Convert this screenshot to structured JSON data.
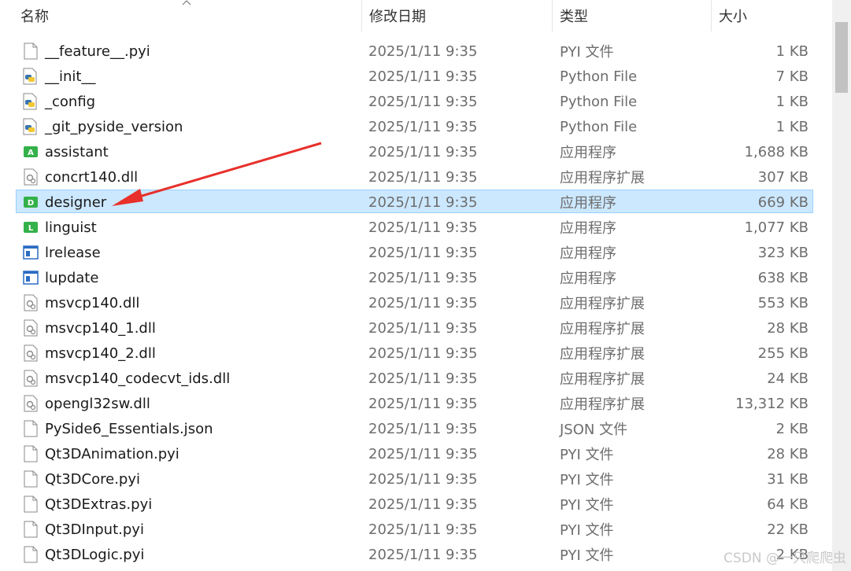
{
  "header": {
    "col_name": "名称",
    "col_date": "修改日期",
    "col_type": "类型",
    "col_size": "大小"
  },
  "files": [
    {
      "name": "__feature__.pyi",
      "date": "2025/1/11 9:35",
      "type": "PYI 文件",
      "size": "1 KB",
      "icon": "doc-icon"
    },
    {
      "name": "__init__",
      "date": "2025/1/11 9:35",
      "type": "Python File",
      "size": "7 KB",
      "icon": "python-icon"
    },
    {
      "name": "_config",
      "date": "2025/1/11 9:35",
      "type": "Python File",
      "size": "1 KB",
      "icon": "python-icon"
    },
    {
      "name": "_git_pyside_version",
      "date": "2025/1/11 9:35",
      "type": "Python File",
      "size": "1 KB",
      "icon": "python-icon"
    },
    {
      "name": "assistant",
      "date": "2025/1/11 9:35",
      "type": "应用程序",
      "size": "1,688 KB",
      "icon": "app-green-icon",
      "letter": "A"
    },
    {
      "name": "concrt140.dll",
      "date": "2025/1/11 9:35",
      "type": "应用程序扩展",
      "size": "307 KB",
      "icon": "dll-icon"
    },
    {
      "name": "designer",
      "date": "2025/1/11 9:35",
      "type": "应用程序",
      "size": "669 KB",
      "icon": "app-green-icon",
      "letter": "D"
    },
    {
      "name": "linguist",
      "date": "2025/1/11 9:35",
      "type": "应用程序",
      "size": "1,077 KB",
      "icon": "app-green-icon",
      "letter": "L"
    },
    {
      "name": "lrelease",
      "date": "2025/1/11 9:35",
      "type": "应用程序",
      "size": "323 KB",
      "icon": "exe-window-icon"
    },
    {
      "name": "lupdate",
      "date": "2025/1/11 9:35",
      "type": "应用程序",
      "size": "638 KB",
      "icon": "exe-window-icon"
    },
    {
      "name": "msvcp140.dll",
      "date": "2025/1/11 9:35",
      "type": "应用程序扩展",
      "size": "553 KB",
      "icon": "dll-icon"
    },
    {
      "name": "msvcp140_1.dll",
      "date": "2025/1/11 9:35",
      "type": "应用程序扩展",
      "size": "28 KB",
      "icon": "dll-icon"
    },
    {
      "name": "msvcp140_2.dll",
      "date": "2025/1/11 9:35",
      "type": "应用程序扩展",
      "size": "255 KB",
      "icon": "dll-icon"
    },
    {
      "name": "msvcp140_codecvt_ids.dll",
      "date": "2025/1/11 9:35",
      "type": "应用程序扩展",
      "size": "24 KB",
      "icon": "dll-icon"
    },
    {
      "name": "opengl32sw.dll",
      "date": "2025/1/11 9:35",
      "type": "应用程序扩展",
      "size": "13,312 KB",
      "icon": "dll-icon"
    },
    {
      "name": "PySide6_Essentials.json",
      "date": "2025/1/11 9:35",
      "type": "JSON 文件",
      "size": "2 KB",
      "icon": "doc-icon"
    },
    {
      "name": "Qt3DAnimation.pyi",
      "date": "2025/1/11 9:35",
      "type": "PYI 文件",
      "size": "28 KB",
      "icon": "doc-icon"
    },
    {
      "name": "Qt3DCore.pyi",
      "date": "2025/1/11 9:35",
      "type": "PYI 文件",
      "size": "31 KB",
      "icon": "doc-icon"
    },
    {
      "name": "Qt3DExtras.pyi",
      "date": "2025/1/11 9:35",
      "type": "PYI 文件",
      "size": "64 KB",
      "icon": "doc-icon"
    },
    {
      "name": "Qt3DInput.pyi",
      "date": "2025/1/11 9:35",
      "type": "PYI 文件",
      "size": "22 KB",
      "icon": "doc-icon"
    },
    {
      "name": "Qt3DLogic.pyi",
      "date": "2025/1/11 9:35",
      "type": "PYI 文件",
      "size": "2 KB",
      "icon": "doc-icon"
    }
  ],
  "selected_index": 6,
  "colors": {
    "selection_bg": "#cce8ff",
    "selection_border": "#99d1ff",
    "annotation_arrow": "#e8302a"
  },
  "watermark": "CSDN @一只爬爬虫"
}
